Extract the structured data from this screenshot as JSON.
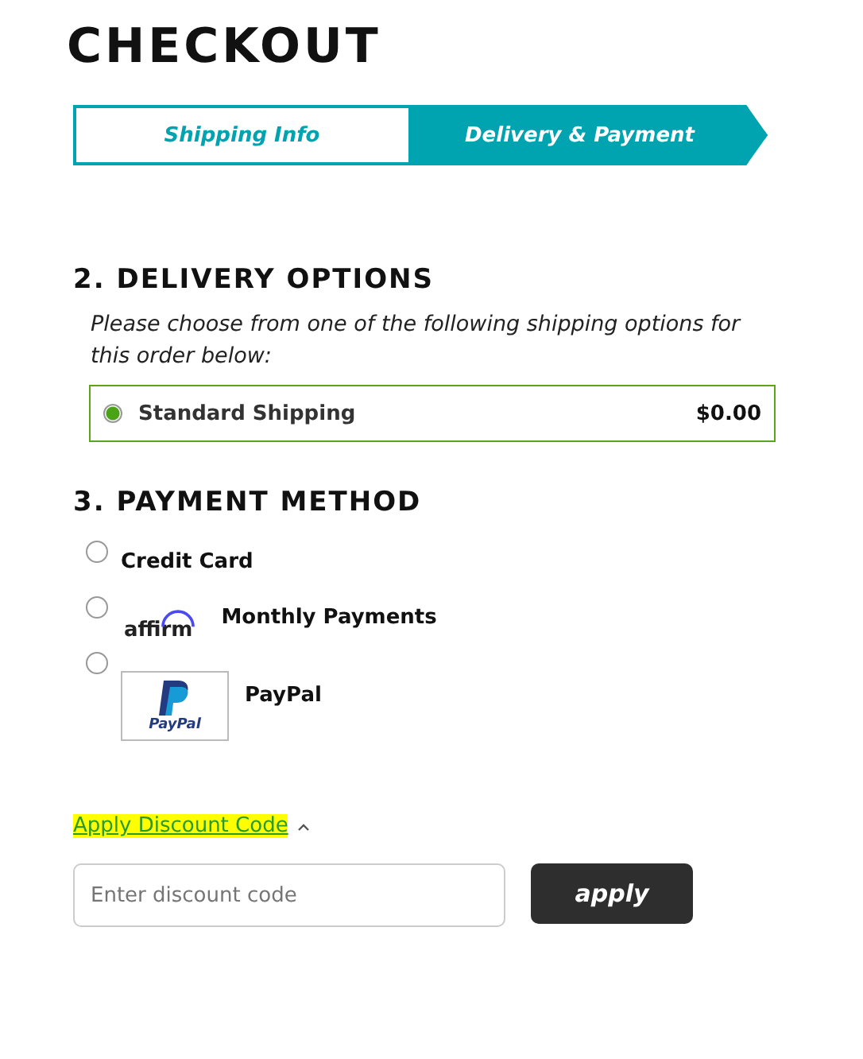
{
  "title": "CHECKOUT",
  "steps": [
    {
      "label": "Shipping Info",
      "selected": false
    },
    {
      "label": "Delivery & Payment",
      "selected": true
    }
  ],
  "delivery": {
    "heading": "2. DELIVERY OPTIONS",
    "note": "Please choose from one of the following shipping options for this order below:",
    "options": [
      {
        "label": "Standard Shipping",
        "price": "$0.00",
        "selected": true
      }
    ]
  },
  "payment": {
    "heading": "3. PAYMENT METHOD",
    "methods": [
      {
        "kind": "plain",
        "label": "Credit Card",
        "selected": false
      },
      {
        "kind": "affirm",
        "logo_text": "affirm",
        "label": "Monthly Payments",
        "selected": false
      },
      {
        "kind": "paypal",
        "logo_text": "PayPal",
        "label": "PayPal",
        "selected": false
      }
    ]
  },
  "discount": {
    "link": "Apply Discount Code",
    "expanded": true,
    "placeholder": "Enter discount code",
    "button": "apply"
  }
}
